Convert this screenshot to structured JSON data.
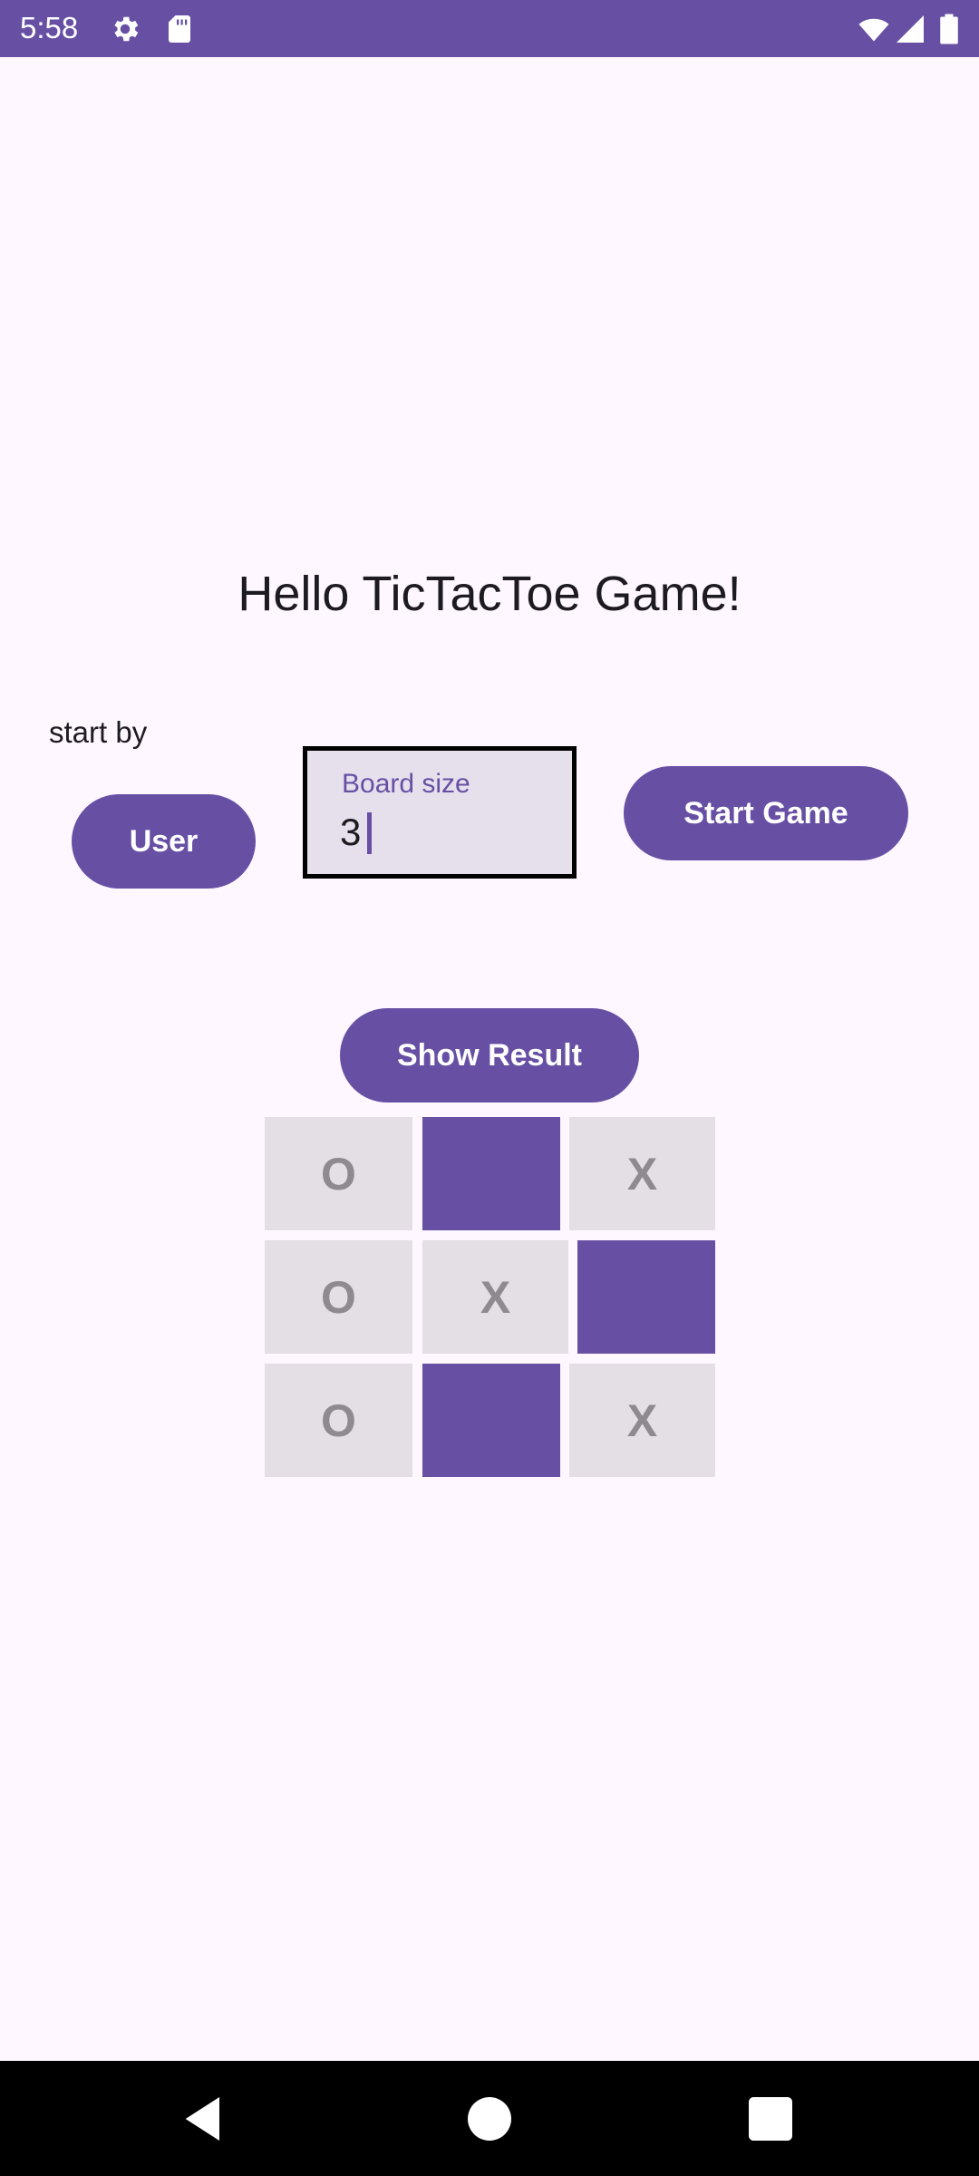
{
  "status_bar": {
    "time": "5:58",
    "icons": [
      "settings-icon",
      "sd-card-icon",
      "wifi-icon",
      "signal-icon",
      "battery-icon"
    ],
    "background": "#6750A4"
  },
  "title": "Hello TicTacToe Game!",
  "start_by": {
    "label": "start by",
    "button_label": "User"
  },
  "board_size": {
    "label": "Board size",
    "value": "3"
  },
  "start_game_label": "Start Game",
  "show_result_label": "Show Result",
  "board": {
    "rows": [
      [
        "O",
        "",
        "X"
      ],
      [
        "O",
        "X",
        ""
      ],
      [
        "O",
        "",
        "X"
      ]
    ]
  },
  "nav_bar": {
    "icons": [
      "back-icon",
      "home-icon",
      "recents-icon"
    ]
  },
  "colors": {
    "accent": "#6750A4",
    "background": "#FEF7FF",
    "cell_light": "#E3DFE4",
    "cell_text": "#8E8A90"
  }
}
